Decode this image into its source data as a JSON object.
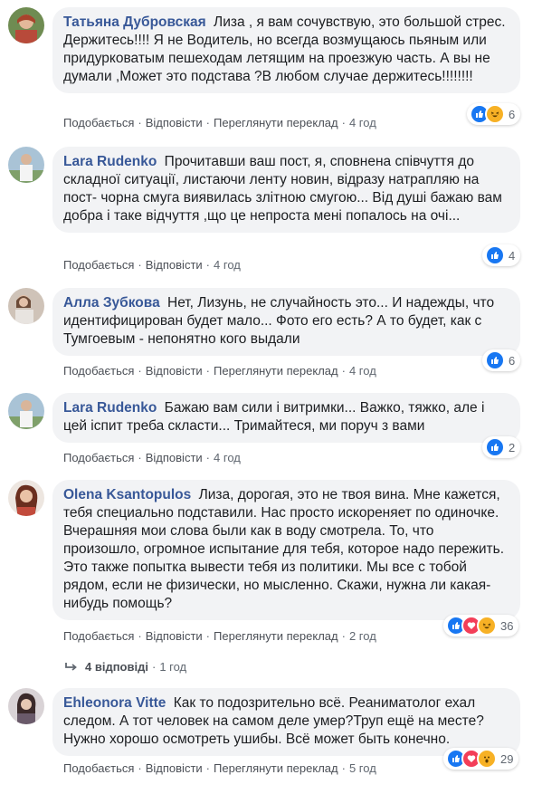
{
  "actions": {
    "like": "Подобається",
    "reply": "Відповісти",
    "translate": "Переглянути переклад",
    "dot": "·"
  },
  "comments": [
    {
      "author": "Татьяна Дубровская",
      "text": "Лиза , я вам сочувствую, это большой стрес. Держитесь!!!! Я не Водитель, но всегда возмущаюсь пьяным или придурковатым пешеходам летящим на проезжую часть. А вы не думали ,Может это подстава ?В любом случае держитесь!!!!!!!!",
      "time": "4 год",
      "reaction_count": "6",
      "reactions": [
        "like-icon",
        "haha-icon"
      ]
    },
    {
      "author": "Lara Rudenko",
      "text": "Прочитавши ваш пост, я, сповнена співчуття до складної ситуації, листаючи ленту новин, відразу натрапляю на пост- чорна смуга виявилась злітною смугою... Від душі бажаю вам добра і таке відчуття ,що це непроста мені попалось на очі...",
      "time": "4 год",
      "reaction_count": "4",
      "reactions": [
        "like-icon"
      ]
    },
    {
      "author": "Алла Зубкова",
      "text": "Нет, Лизунь, не случайность это... И надежды, что идентифицирован будет мало... Фото его есть? А то будет, как с Тумгоевым - непонятно кого выдали",
      "time": "4 год",
      "reaction_count": "6",
      "reactions": [
        "like-icon"
      ]
    },
    {
      "author": "Lara Rudenko",
      "text": "Бажаю вам сили і витримки... Важко, тяжко, але і цей іспит треба скласти... Тримайтеся, ми поруч з вами",
      "time": "4 год",
      "reaction_count": "2",
      "reactions": [
        "like-icon"
      ]
    },
    {
      "author": "Olena Ksantopulos",
      "text": "Лиза, дорогая, это не твоя вина. Мне кажется, тебя специально подставили. Нас просто искореняет по одиночке. Вчерашняя мои слова были как в воду смотрела. То, что произошло, огромное испытание для тебя, которое надо пережить. Это также попытка вывести тебя из политики. Мы все с тобой рядом, если не физически, но мысленно. Скажи, нужна ли какая-нибудь помощь?",
      "time": "2 год",
      "reaction_count": "36",
      "reactions": [
        "like-icon",
        "love-icon",
        "haha-icon"
      ]
    },
    {
      "author": "Ehleonora Vitte",
      "text": "Как то подозрительно всё. Реаниматолог ехал следом. А тот человек на самом деле умер?Труп ещё на месте? Нужно хорошо осмотреть ушибы. Всё может быть конечно.",
      "time": "5 год",
      "reaction_count": "29",
      "reactions": [
        "like-icon",
        "love-icon",
        "wow-icon"
      ]
    }
  ],
  "replies": {
    "icon": "reply-arrow-icon",
    "label": "4 відповіді",
    "time": "1 год"
  }
}
